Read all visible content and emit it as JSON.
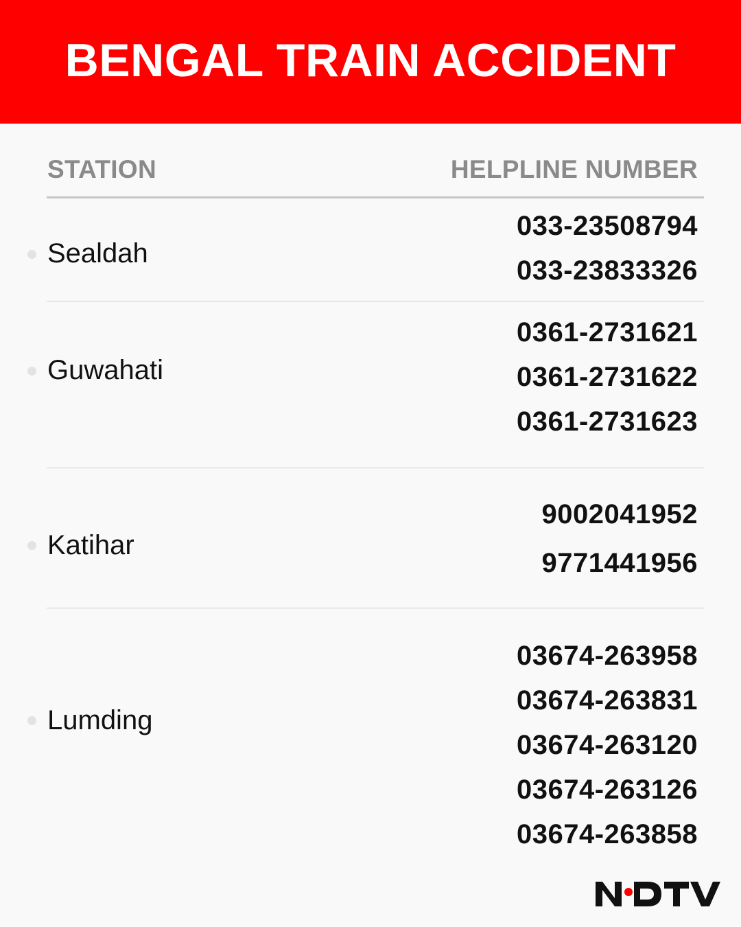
{
  "banner": {
    "title": "BENGAL TRAIN ACCIDENT"
  },
  "table": {
    "headers": {
      "station": "STATION",
      "helpline": "HELPLINE NUMBER"
    },
    "rows": [
      {
        "station": "Sealdah",
        "numbers": [
          "033-23508794",
          "033-23833326"
        ]
      },
      {
        "station": "Guwahati",
        "numbers": [
          "0361-2731621",
          "0361-2731622",
          "0361-2731623"
        ]
      },
      {
        "station": "Katihar",
        "numbers": [
          "9002041952",
          "9771441956"
        ]
      },
      {
        "station": "Lumding",
        "numbers": [
          "03674-263958",
          "03674-263831",
          "03674-263120",
          "03674-263126",
          "03674-263858"
        ]
      }
    ]
  },
  "logo": {
    "text": "NDTV",
    "dot_color": "#ff0000"
  },
  "colors": {
    "banner": "#ff0000",
    "header_text": "#8a8a8a",
    "body_text": "#111111"
  }
}
